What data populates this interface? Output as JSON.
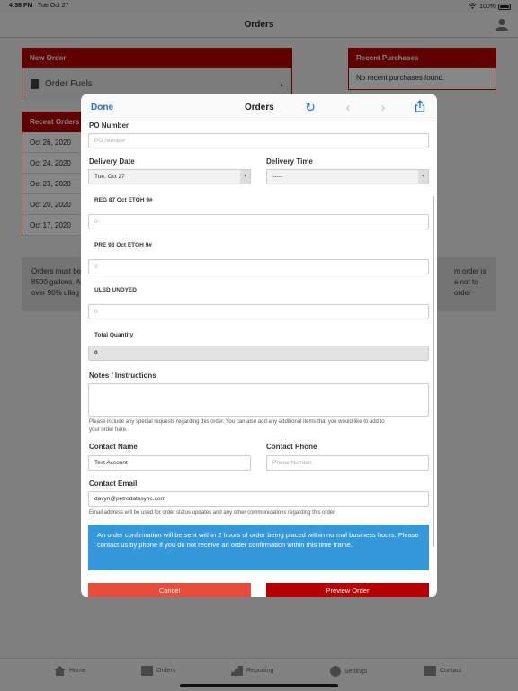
{
  "status": {
    "time": "4:36 PM",
    "date": "Tue Oct 27",
    "battery": "100%"
  },
  "nav": {
    "title": "Orders"
  },
  "new_order": {
    "header": "New Order",
    "row_label": "Order Fuels"
  },
  "recent_purchases": {
    "header": "Recent Purchases",
    "empty": "No recent purchases found."
  },
  "recent_orders": {
    "header": "Recent Orders",
    "items": [
      "Oct 26, 2020",
      "Oct 24, 2020",
      "Oct 23, 2020",
      "Oct 20, 2020",
      "Oct 17, 2020"
    ]
  },
  "notice": {
    "left_lines": [
      "Orders must be",
      "8500 gallons. A",
      "over 90% ullag"
    ],
    "right_lines": [
      "m order is",
      "e not to order",
      ""
    ]
  },
  "tabs": [
    "Home",
    "Orders",
    "Reporting",
    "Settings",
    "Contact"
  ],
  "modal": {
    "done": "Done",
    "title": "Orders",
    "po_label": "PO Number",
    "po_placeholder": "PO Number",
    "delivery_date_label": "Delivery Date",
    "delivery_date_value": "Tue, Oct 27",
    "delivery_time_label": "Delivery Time",
    "delivery_time_value": "-----",
    "products": [
      {
        "name": "REG 87 Oct ETOH 9#",
        "qty": "0"
      },
      {
        "name": "PRE 93 Oct ETOH 9#",
        "qty": "0"
      },
      {
        "name": "ULSD UNDYED",
        "qty": "0"
      }
    ],
    "total_label": "Total Quantity",
    "total_value": "0",
    "notes_label": "Notes / Instructions",
    "notes_help_1": "Please include any special requests regarding this order. You can also add any additional items that you would like to add to",
    "notes_help_2": "your order here.",
    "contact_name_label": "Contact Name",
    "contact_name_value": "Test Account",
    "contact_phone_label": "Contact Phone",
    "contact_phone_placeholder": "Phone Number",
    "contact_email_label": "Contact Email",
    "contact_email_value": "davyn@petrodatasync.com",
    "email_help": "Email address will be used for order status updates and any other communications regarding this order.",
    "info": "An order confirmation will be sent within 2 hours of order being placed within normal business hours. Please contact us by phone if you do not receive an order confirmation within this time frame.",
    "cancel": "Cancel",
    "preview": "Preview Order"
  },
  "colors": {
    "brand_red": "#b50000",
    "info_blue": "#3498db",
    "cancel_red": "#e74c3c",
    "link_blue": "#2a6ccf"
  }
}
